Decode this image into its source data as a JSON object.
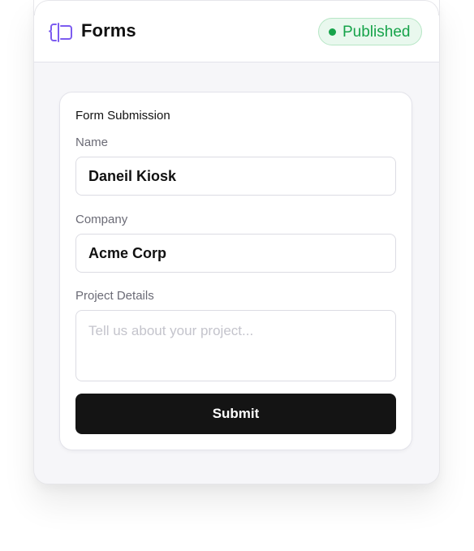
{
  "header": {
    "logo_icon": "brackets-logo-icon",
    "title": "Forms",
    "status": {
      "label": "Published",
      "color": "#16a34a",
      "background": "#e9f8ee"
    }
  },
  "form": {
    "title": "Form Submission",
    "fields": {
      "name": {
        "label": "Name",
        "value": "Daneil Kiosk"
      },
      "company": {
        "label": "Company",
        "value": "Acme Corp"
      },
      "project_details": {
        "label": "Project Details",
        "value": "",
        "placeholder": "Tell us about your project..."
      }
    },
    "submit_label": "Submit"
  },
  "colors": {
    "accent": "#7c5cf0",
    "button": "#141414",
    "window_background": "#f6f6f9"
  }
}
